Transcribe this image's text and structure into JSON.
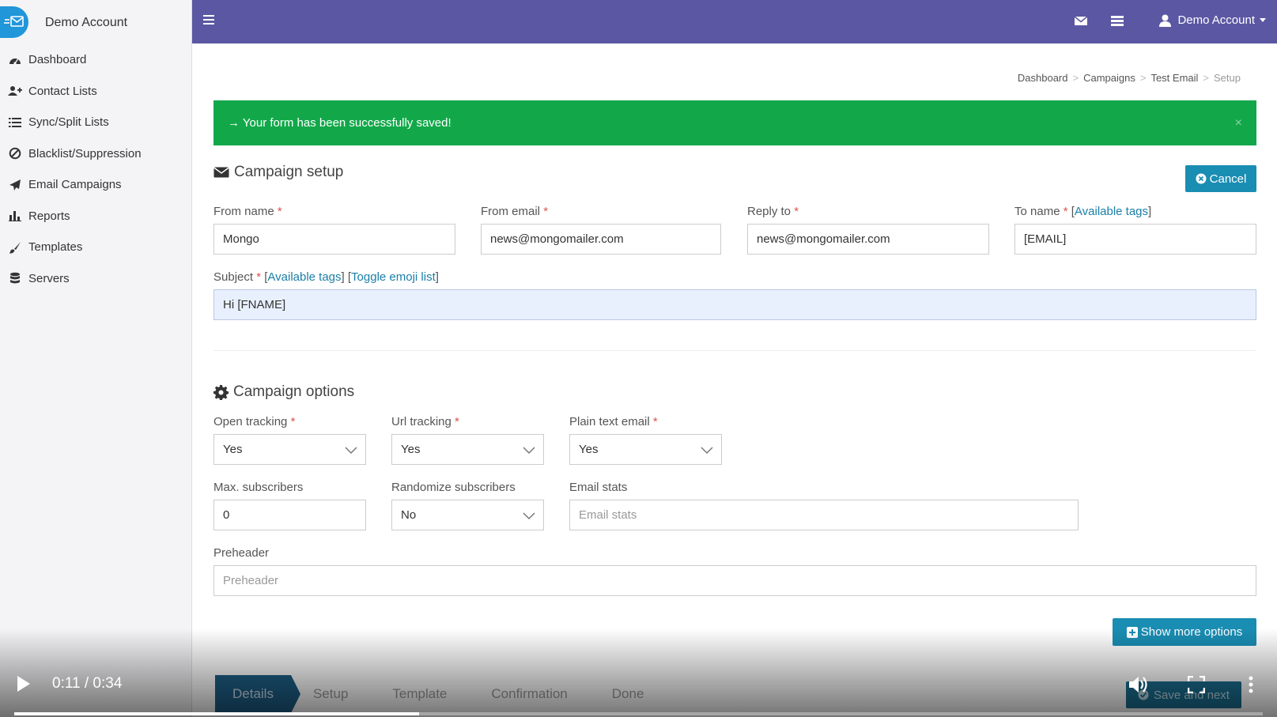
{
  "sidebar": {
    "account_name": "Demo Account",
    "items": [
      {
        "label": "Dashboard",
        "icon": "dashboard-icon"
      },
      {
        "label": "Contact Lists",
        "icon": "users-icon"
      },
      {
        "label": "Sync/Split Lists",
        "icon": "list-icon"
      },
      {
        "label": "Blacklist/Suppression",
        "icon": "ban-icon"
      },
      {
        "label": "Email Campaigns",
        "icon": "paper-plane-icon"
      },
      {
        "label": "Reports",
        "icon": "bar-chart-icon"
      },
      {
        "label": "Templates",
        "icon": "paintbrush-icon"
      },
      {
        "label": "Servers",
        "icon": "database-icon"
      }
    ]
  },
  "topbar": {
    "user_label": "Demo Account",
    "bg_color": "#5b57a3"
  },
  "breadcrumb": [
    "Dashboard",
    "Campaigns",
    "Test Email",
    "Setup"
  ],
  "alert": {
    "message": "→ Your form has been successfully saved!",
    "close": "×",
    "color": "#12a84a"
  },
  "campaign_setup": {
    "title": "Campaign setup",
    "cancel_label": "Cancel",
    "from_name": {
      "label": "From name",
      "value": "Mongo"
    },
    "from_email": {
      "label": "From email",
      "value": "news@mongomailer.com"
    },
    "reply_to": {
      "label": "Reply to",
      "value": "news@mongomailer.com"
    },
    "to_name": {
      "label": "To name",
      "link": "Available tags",
      "value": "[EMAIL]"
    },
    "subject": {
      "label": "Subject",
      "link1": "Available tags",
      "link2": "Toggle emoji list",
      "value": "Hi [FNAME]"
    }
  },
  "campaign_options": {
    "title": "Campaign options",
    "open_tracking": {
      "label": "Open tracking",
      "value": "Yes"
    },
    "url_tracking": {
      "label": "Url tracking",
      "value": "Yes"
    },
    "plain_text": {
      "label": "Plain text email",
      "value": "Yes"
    },
    "max_subscribers": {
      "label": "Max. subscribers",
      "value": "0"
    },
    "randomize": {
      "label": "Randomize subscribers",
      "value": "No"
    },
    "email_stats": {
      "label": "Email stats",
      "placeholder": "Email stats"
    },
    "preheader": {
      "label": "Preheader",
      "placeholder": "Preheader"
    },
    "show_more_label": "Show more options"
  },
  "wizard": {
    "steps": [
      "Details",
      "Setup",
      "Template",
      "Confirmation",
      "Done"
    ],
    "active": "Details",
    "save_next": "Save and next"
  },
  "video": {
    "timecode": "0:11 / 0:34",
    "progress": 0.324
  },
  "colors": {
    "accent": "#1a8db3",
    "required": "#d9534f",
    "link": "#1a7fa8"
  }
}
